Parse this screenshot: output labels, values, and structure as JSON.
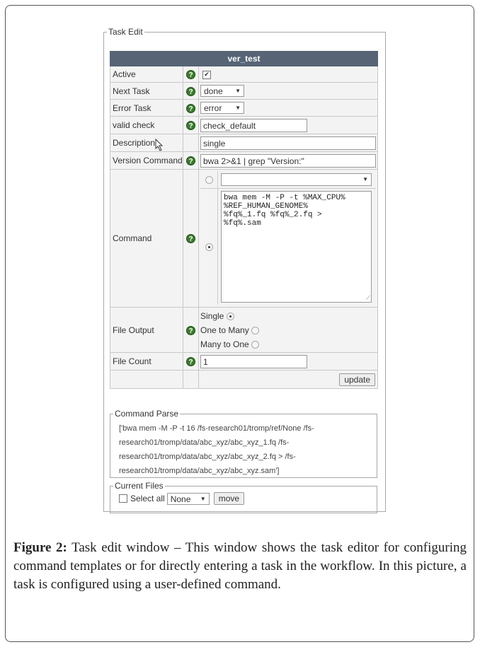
{
  "task_edit": {
    "legend": "Task Edit",
    "header": "ver_test",
    "rows": {
      "active": {
        "label": "Active",
        "checked": true
      },
      "next_task": {
        "label": "Next Task",
        "value": "done"
      },
      "error_task": {
        "label": "Error Task",
        "value": "error"
      },
      "valid_check": {
        "label": "valid check",
        "value": "check_default"
      },
      "description": {
        "label": "Description",
        "value": "single"
      },
      "version_command": {
        "label": "Version Command",
        "value": "bwa 2>&1 | grep \"Version:\""
      },
      "command": {
        "label": "Command",
        "dropdown_value": "",
        "text": "bwa mem -M -P -t %MAX_CPU%\n%REF_HUMAN_GENOME%\n%fq%_1.fq %fq%_2.fq >\n%fq%.sam"
      },
      "file_output": {
        "label": "File Output",
        "options": [
          "Single",
          "One to Many",
          "Many to One"
        ],
        "selected": "Single"
      },
      "file_count": {
        "label": "File Count",
        "value": "1"
      }
    },
    "update_label": "update",
    "help_icon": "question-icon"
  },
  "command_parse": {
    "legend": "Command Parse",
    "lines": [
      "['bwa mem -M -P -t 16 /fs-research01/tromp/ref/None /fs-",
      "research01/tromp/data/abc_xyz/abc_xyz_1.fq /fs-",
      "research01/tromp/data/abc_xyz/abc_xyz_2.fq > /fs-",
      "research01/tromp/data/abc_xyz/abc_xyz.sam']"
    ]
  },
  "current_files": {
    "legend": "Current Files",
    "select_all_label": "Select all",
    "select_value": "None",
    "move_label": "move"
  },
  "caption": {
    "figure_label": "Figure 2:",
    "text": " Task edit window – This window shows the task editor for configuring command templates or for directly entering a task in the workflow. In this picture, a task is configured using a user-defined command."
  },
  "colors": {
    "header_bg": "#566476",
    "help_icon": "#3c7a2f"
  }
}
